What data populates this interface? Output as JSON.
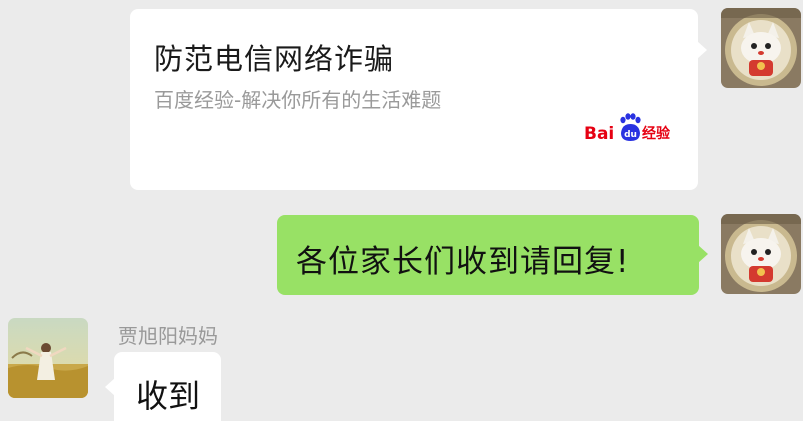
{
  "messages": {
    "link_card": {
      "title": "防范电信网络诈骗",
      "description": "百度经验-解决你所有的生活难题",
      "source_logo": {
        "text_bai": "Bai",
        "text_du": "du",
        "text_jingyan": "经验",
        "icon": "baidu-paw-logo"
      }
    },
    "outgoing_text": "各位家长们收到请回复!",
    "incoming": {
      "sender_name": "贾旭阳妈妈",
      "text": "收到"
    }
  },
  "avatars": {
    "self_icon": "cat-figurine-avatar",
    "other_icon": "girl-in-field-avatar"
  },
  "colors": {
    "background": "#ebebeb",
    "outgoing_bubble": "#98e165",
    "incoming_bubble": "#ffffff",
    "baidu_red": "#e60012",
    "baidu_blue": "#2932e1"
  }
}
